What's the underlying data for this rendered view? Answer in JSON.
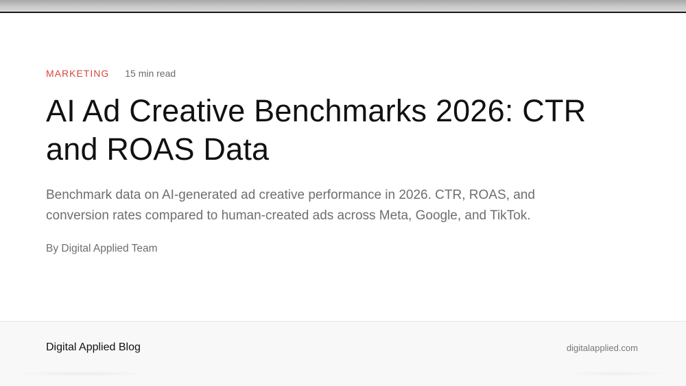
{
  "article": {
    "category": "MARKETING",
    "read_time": "15 min read",
    "title": "AI Ad Creative Benchmarks 2026: CTR and ROAS Data",
    "subtitle": "Benchmark data on AI-generated ad creative performance in 2026. CTR, ROAS, and conversion rates compared to human-created ads across Meta, Google, and TikTok.",
    "byline": "By Digital Applied Team"
  },
  "footer": {
    "brand": "Digital Applied Blog",
    "domain": "digitalapplied.com"
  },
  "colors": {
    "category_accent": "#d6453d",
    "title_text": "#111111",
    "muted_text": "#6e6e6e",
    "footer_background": "#f8f8f8"
  }
}
